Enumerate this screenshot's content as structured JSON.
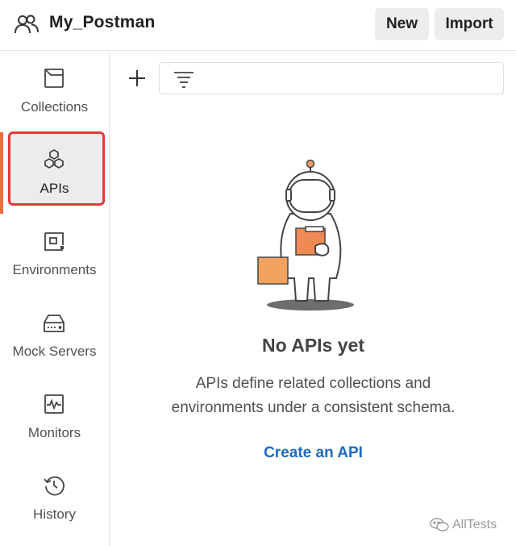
{
  "header": {
    "workspace_icon": "people-icon",
    "workspace_name": "My_Postman",
    "new_label": "New",
    "import_label": "Import"
  },
  "sidebar": {
    "items": [
      {
        "label": "Collections",
        "icon": "collections-icon"
      },
      {
        "label": "APIs",
        "icon": "apis-icon",
        "active": true
      },
      {
        "label": "Environments",
        "icon": "environments-icon"
      },
      {
        "label": "Mock Servers",
        "icon": "mock-server-icon"
      },
      {
        "label": "Monitors",
        "icon": "monitor-icon"
      },
      {
        "label": "History",
        "icon": "history-icon"
      }
    ]
  },
  "toolbar": {
    "add_icon": "plus-icon",
    "filter_icon": "filter-icon"
  },
  "empty_state": {
    "title": "No APIs yet",
    "description_line1": "APIs define related collections and",
    "description_line2": "environments under a consistent schema.",
    "cta": "Create an API"
  },
  "watermark": {
    "text": "AllTests"
  },
  "colors": {
    "accent": "#f26b3a",
    "link": "#1f6ac0",
    "highlight_border": "#e03a3a"
  }
}
